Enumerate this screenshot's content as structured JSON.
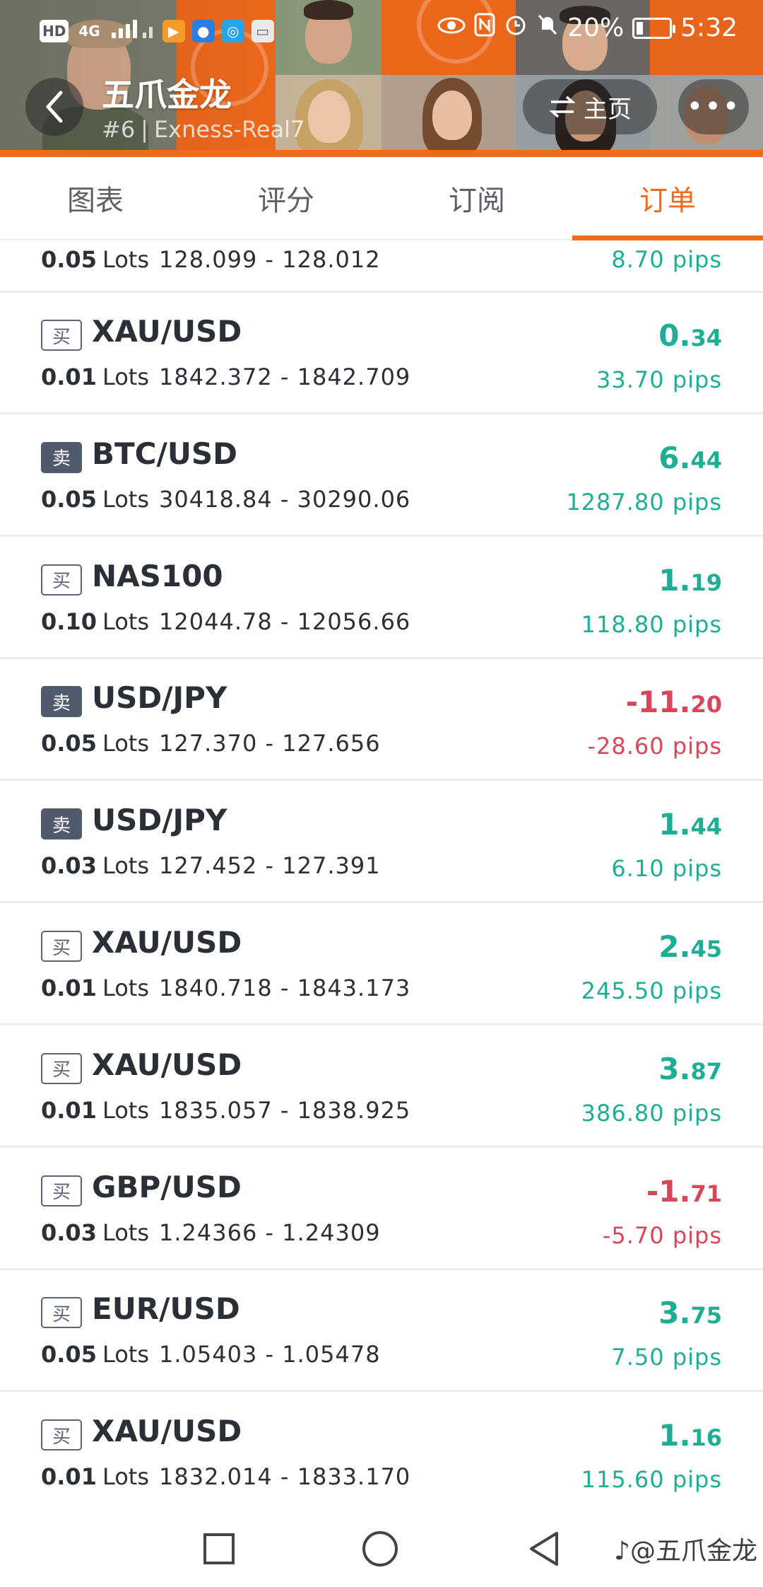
{
  "status_bar": {
    "network_label": "4G",
    "hd_label": "HD",
    "battery_percent": "20%",
    "time": "5:32",
    "battery_level": 0.2
  },
  "header": {
    "title": "五爪金龙",
    "rank": "#6",
    "separator": "|",
    "account": "Exness-Real7",
    "home_label": "主页",
    "more_label": "•••"
  },
  "tabs": [
    {
      "label": "图表",
      "active": false
    },
    {
      "label": "评分",
      "active": false
    },
    {
      "label": "订阅",
      "active": false
    },
    {
      "label": "订单",
      "active": true
    }
  ],
  "lots_unit": "Lots",
  "partial_order": {
    "lots": "0.05",
    "range": "128.099 - 128.012",
    "pips": "8.70 pips",
    "direction": "positive"
  },
  "orders": [
    {
      "side": "买",
      "side_type": "buy",
      "symbol": "XAU/USD",
      "lots": "0.01",
      "range": "1842.372 - 1842.709",
      "profit_int": "0.",
      "profit_dec": "34",
      "pips": "33.70 pips",
      "direction": "positive"
    },
    {
      "side": "卖",
      "side_type": "sell",
      "symbol": "BTC/USD",
      "lots": "0.05",
      "range": "30418.84 - 30290.06",
      "profit_int": "6.",
      "profit_dec": "44",
      "pips": "1287.80 pips",
      "direction": "positive"
    },
    {
      "side": "买",
      "side_type": "buy",
      "symbol": "NAS100",
      "lots": "0.10",
      "range": "12044.78 - 12056.66",
      "profit_int": "1.",
      "profit_dec": "19",
      "pips": "118.80 pips",
      "direction": "positive"
    },
    {
      "side": "卖",
      "side_type": "sell",
      "symbol": "USD/JPY",
      "lots": "0.05",
      "range": "127.370 - 127.656",
      "profit_int": "-11.",
      "profit_dec": "20",
      "pips": "-28.60 pips",
      "direction": "negative"
    },
    {
      "side": "卖",
      "side_type": "sell",
      "symbol": "USD/JPY",
      "lots": "0.03",
      "range": "127.452 - 127.391",
      "profit_int": "1.",
      "profit_dec": "44",
      "pips": "6.10 pips",
      "direction": "positive"
    },
    {
      "side": "买",
      "side_type": "buy",
      "symbol": "XAU/USD",
      "lots": "0.01",
      "range": "1840.718 - 1843.173",
      "profit_int": "2.",
      "profit_dec": "45",
      "pips": "245.50 pips",
      "direction": "positive"
    },
    {
      "side": "买",
      "side_type": "buy",
      "symbol": "XAU/USD",
      "lots": "0.01",
      "range": "1835.057 - 1838.925",
      "profit_int": "3.",
      "profit_dec": "87",
      "pips": "386.80 pips",
      "direction": "positive"
    },
    {
      "side": "买",
      "side_type": "buy",
      "symbol": "GBP/USD",
      "lots": "0.03",
      "range": "1.24366 - 1.24309",
      "profit_int": "-1.",
      "profit_dec": "71",
      "pips": "-5.70 pips",
      "direction": "negative"
    },
    {
      "side": "买",
      "side_type": "buy",
      "symbol": "EUR/USD",
      "lots": "0.05",
      "range": "1.05403 - 1.05478",
      "profit_int": "3.",
      "profit_dec": "75",
      "pips": "7.50 pips",
      "direction": "positive"
    },
    {
      "side": "买",
      "side_type": "buy",
      "symbol": "XAU/USD",
      "lots": "0.01",
      "range": "1832.014 - 1833.170",
      "profit_int": "1.",
      "profit_dec": "16",
      "pips": "115.60 pips",
      "direction": "positive"
    }
  ],
  "navbar": {
    "watermark": "@五爪金龙",
    "buttons": [
      "recent-apps",
      "home",
      "back"
    ]
  },
  "colors": {
    "accent": "#f26a1b",
    "positive": "#1fae93",
    "negative": "#d6475a",
    "badge_sell": "#4f5a6c"
  }
}
